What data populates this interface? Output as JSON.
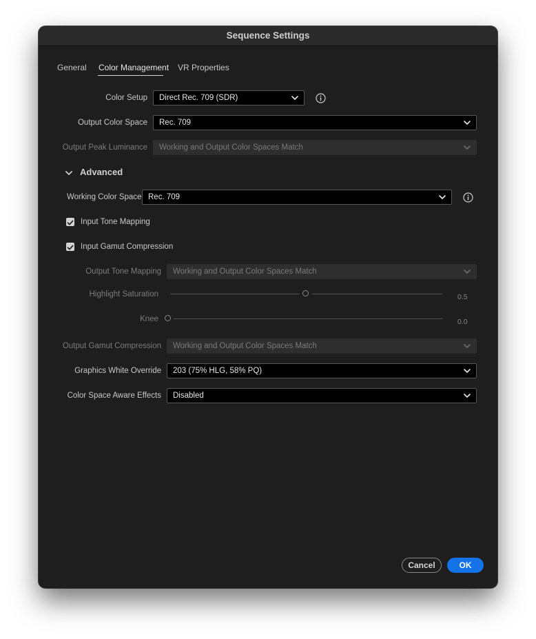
{
  "window": {
    "title": "Sequence Settings"
  },
  "tabs": [
    {
      "label": "General"
    },
    {
      "label": "Color Management"
    },
    {
      "label": "VR Properties"
    }
  ],
  "color_setup": {
    "label": "Color Setup",
    "value": "Direct Rec. 709 (SDR)"
  },
  "output_color_space": {
    "label": "Output Color Space",
    "value": "Rec. 709"
  },
  "output_peak_luminance": {
    "label": "Output Peak Luminance",
    "value": "Working and Output Color Spaces Match",
    "enabled": false
  },
  "advanced": {
    "label": "Advanced",
    "expanded": true,
    "working_color_space": {
      "label": "Working Color Space",
      "value": "Rec. 709"
    },
    "input_tone_mapping": {
      "label": "Input Tone Mapping",
      "checked": true
    },
    "input_gamut_compression": {
      "label": "Input Gamut Compression",
      "checked": true
    },
    "output_tone_mapping": {
      "label": "Output Tone Mapping",
      "value": "Working and Output Color Spaces Match",
      "enabled": false
    },
    "highlight_saturation": {
      "label": "Highlight Saturation",
      "value": "0.5",
      "fraction": 0.5,
      "enabled": false
    },
    "knee": {
      "label": "Knee",
      "value": "0.0",
      "fraction": 0.0,
      "enabled": false
    },
    "output_gamut_compression": {
      "label": "Output Gamut Compression",
      "value": "Working and Output Color Spaces Match",
      "enabled": false
    },
    "graphics_white_override": {
      "label": "Graphics White Override",
      "value": "203 (75% HLG, 58% PQ)"
    },
    "color_space_aware_effects": {
      "label": "Color Space Aware Effects",
      "value": "Disabled"
    }
  },
  "buttons": {
    "cancel": "Cancel",
    "ok": "OK"
  },
  "colors": {
    "accent": "#1473e6",
    "background": "#1e1e1e",
    "field": "#000000"
  }
}
